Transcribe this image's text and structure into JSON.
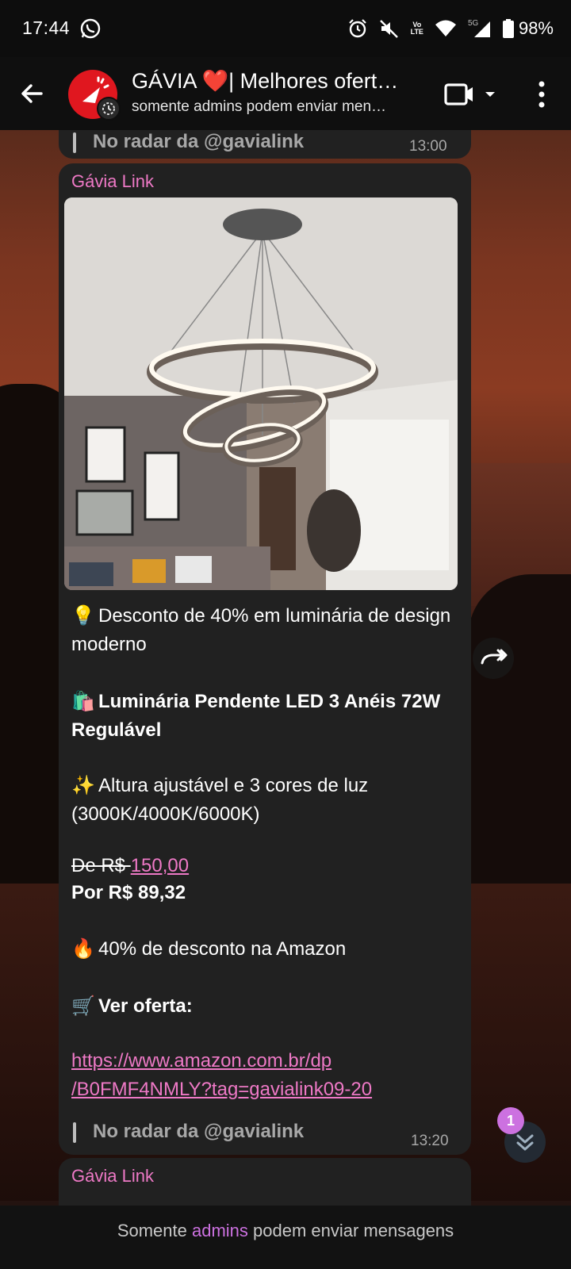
{
  "status_bar": {
    "time": "17:44",
    "network": "5G",
    "lte": "LTE",
    "volte": "Vo",
    "battery": "98%"
  },
  "header": {
    "title": "GÁVIA ❤️| Melhores ofert…",
    "subtitle": "somente admins podem enviar men…"
  },
  "prev_message": {
    "quote": "No radar da @gavialink",
    "time": "13:00"
  },
  "message": {
    "sender": "Gávia Link",
    "line1_emoji": "💡",
    "line1": "Desconto de 40% em luminária de design moderno",
    "line2_emoji": "🛍️",
    "line2": "Luminária Pendente LED 3 Anéis 72W Regulável",
    "line3_emoji": "✨",
    "line3": "Altura ajustável e 3 cores de luz (3000K/4000K/6000K)",
    "price_old_prefix": "De R$ ",
    "price_old": "150,00",
    "price_new": "Por R$ 89,32",
    "line4_emoji": "🔥",
    "line4": "40% de desconto na Amazon",
    "cta_emoji": "🛒",
    "cta": "Ver oferta:",
    "link_line1": "https://www.amazon.com.br/dp",
    "link_line2": "/B0FMF4NMLY?tag=gavialink09-20",
    "quote": "No radar da @gavialink",
    "time": "13:20"
  },
  "next_message": {
    "sender": "Gávia Link"
  },
  "unread_count": "1",
  "footer": {
    "prefix": "Somente ",
    "highlight": "admins",
    "suffix": " podem enviar mensagens"
  },
  "colors": {
    "accent_pink": "#ee79c6",
    "accent_purple": "#cc71e0",
    "bubble": "#212121"
  }
}
